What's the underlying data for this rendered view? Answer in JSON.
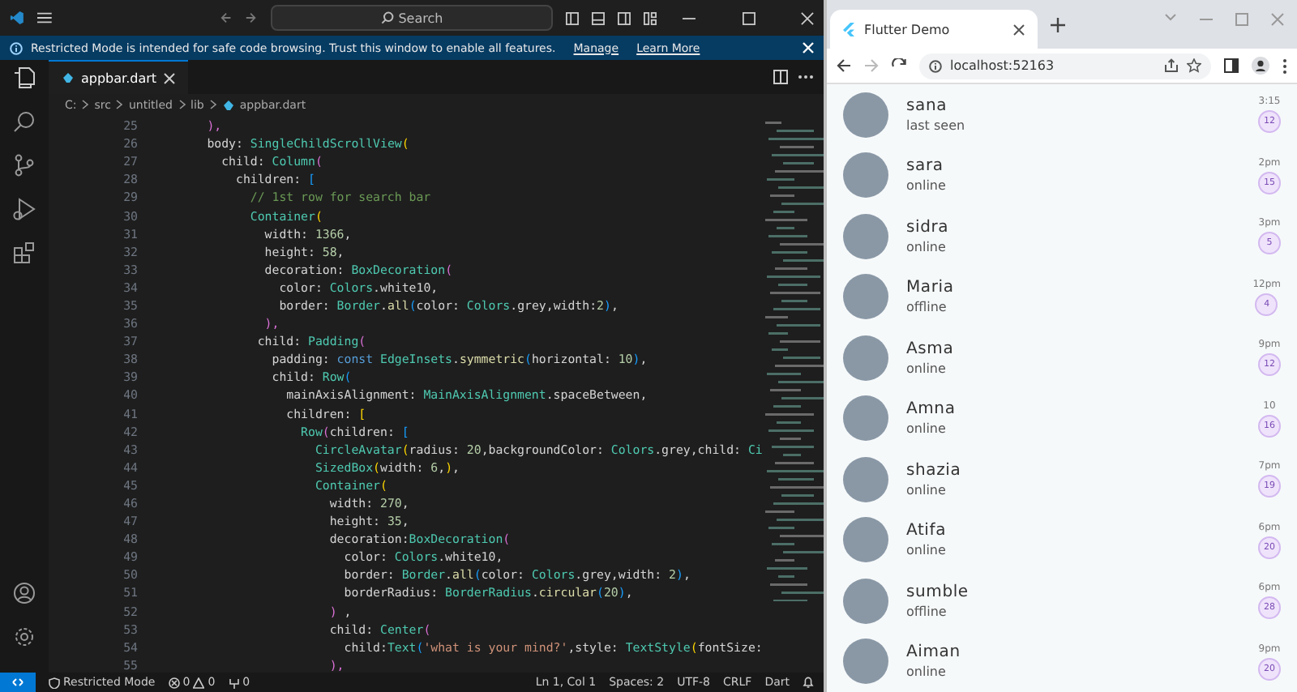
{
  "vscode": {
    "title_bar": {
      "search_placeholder": "Search"
    },
    "banner": {
      "message": "Restricted Mode is intended for safe code browsing. Trust this window to enable all features.",
      "links": [
        "Manage",
        "Learn More"
      ]
    },
    "tabs": [
      {
        "label": "appbar.dart",
        "selected": true
      }
    ],
    "breadcrumb": [
      "C:",
      "src",
      "untitled",
      "lib",
      "appbar.dart"
    ],
    "code_lines": [
      {
        "number": "25",
        "tokens": [
          {
            "text": "      ),",
            "kind": "bracket2"
          }
        ]
      },
      {
        "number": "26",
        "tokens": [
          {
            "text": "      body: ",
            "kind": "plain"
          },
          {
            "text": "SingleChildScrollView",
            "kind": "type"
          },
          {
            "text": "(",
            "kind": "bracket"
          }
        ]
      },
      {
        "number": "27",
        "tokens": [
          {
            "text": "        child: ",
            "kind": "plain"
          },
          {
            "text": "Column",
            "kind": "type"
          },
          {
            "text": "(",
            "kind": "bracket2"
          }
        ]
      },
      {
        "number": "28",
        "tokens": [
          {
            "text": "          children: ",
            "kind": "plain"
          },
          {
            "text": "[",
            "kind": "bracket3"
          }
        ]
      },
      {
        "number": "29",
        "tokens": [
          {
            "text": "            // 1st row for search bar",
            "kind": "comment"
          }
        ]
      },
      {
        "number": "30",
        "tokens": [
          {
            "text": "            Container",
            "kind": "type"
          },
          {
            "text": "(",
            "kind": "bracket"
          }
        ]
      },
      {
        "number": "31",
        "tokens": [
          {
            "text": "              width: ",
            "kind": "plain"
          },
          {
            "text": "1366",
            "kind": "number"
          },
          {
            "text": ",",
            "kind": "plain"
          }
        ]
      },
      {
        "number": "32",
        "tokens": [
          {
            "text": "              height: ",
            "kind": "plain"
          },
          {
            "text": "58",
            "kind": "number"
          },
          {
            "text": ",",
            "kind": "plain"
          }
        ]
      },
      {
        "number": "33",
        "tokens": [
          {
            "text": "              decoration: ",
            "kind": "plain"
          },
          {
            "text": "BoxDecoration",
            "kind": "type"
          },
          {
            "text": "(",
            "kind": "bracket2"
          }
        ]
      },
      {
        "number": "34",
        "tokens": [
          {
            "text": "                color: ",
            "kind": "plain"
          },
          {
            "text": "Colors",
            "kind": "type"
          },
          {
            "text": ".white10,",
            "kind": "plain"
          }
        ]
      },
      {
        "number": "35",
        "tokens": [
          {
            "text": "                border: ",
            "kind": "plain"
          },
          {
            "text": "Border",
            "kind": "type"
          },
          {
            "text": ".",
            "kind": "plain"
          },
          {
            "text": "all",
            "kind": "method"
          },
          {
            "text": "(",
            "kind": "bracket3"
          },
          {
            "text": "color: ",
            "kind": "plain"
          },
          {
            "text": "Colors",
            "kind": "type"
          },
          {
            "text": ".grey,width:",
            "kind": "plain"
          },
          {
            "text": "2",
            "kind": "number"
          },
          {
            "text": ")",
            "kind": "bracket3"
          },
          {
            "text": ",",
            "kind": "plain"
          }
        ]
      },
      {
        "number": "36",
        "tokens": [
          {
            "text": "              ),",
            "kind": "bracket2"
          }
        ]
      },
      {
        "number": "37",
        "tokens": [
          {
            "text": "             child: ",
            "kind": "plain"
          },
          {
            "text": "Padding",
            "kind": "type"
          },
          {
            "text": "(",
            "kind": "bracket2"
          }
        ]
      },
      {
        "number": "38",
        "tokens": [
          {
            "text": "               padding: ",
            "kind": "plain"
          },
          {
            "text": "const ",
            "kind": "keyword"
          },
          {
            "text": "EdgeInsets",
            "kind": "type"
          },
          {
            "text": ".",
            "kind": "plain"
          },
          {
            "text": "symmetric",
            "kind": "method"
          },
          {
            "text": "(",
            "kind": "bracket3"
          },
          {
            "text": "horizontal: ",
            "kind": "plain"
          },
          {
            "text": "10",
            "kind": "number"
          },
          {
            "text": ")",
            "kind": "bracket3"
          },
          {
            "text": ",",
            "kind": "plain"
          }
        ]
      },
      {
        "number": "39",
        "tokens": [
          {
            "text": "               child: ",
            "kind": "plain"
          },
          {
            "text": "Row",
            "kind": "type"
          },
          {
            "text": "(",
            "kind": "bracket3"
          }
        ]
      },
      {
        "number": "40",
        "tokens": [
          {
            "text": "                 mainAxisAlignment: ",
            "kind": "plain"
          },
          {
            "text": "MainAxisAlignment",
            "kind": "type"
          },
          {
            "text": ".spaceBetween,",
            "kind": "plain"
          }
        ]
      },
      {
        "number": "41",
        "tokens": [
          {
            "text": "                 children: ",
            "kind": "plain"
          },
          {
            "text": "[",
            "kind": "bracket"
          }
        ]
      },
      {
        "number": "42",
        "tokens": [
          {
            "text": "                   Row",
            "kind": "type"
          },
          {
            "text": "(",
            "kind": "bracket2"
          },
          {
            "text": "children: ",
            "kind": "plain"
          },
          {
            "text": "[",
            "kind": "bracket3"
          }
        ]
      },
      {
        "number": "43",
        "tokens": [
          {
            "text": "                     CircleAvatar",
            "kind": "type"
          },
          {
            "text": "(",
            "kind": "bracket"
          },
          {
            "text": "radius: ",
            "kind": "plain"
          },
          {
            "text": "20",
            "kind": "number"
          },
          {
            "text": ",backgroundColor: ",
            "kind": "plain"
          },
          {
            "text": "Colors",
            "kind": "type"
          },
          {
            "text": ".grey,child: ",
            "kind": "plain"
          },
          {
            "text": "Ci",
            "kind": "type"
          }
        ]
      },
      {
        "number": "44",
        "tokens": [
          {
            "text": "                     SizedBox",
            "kind": "type"
          },
          {
            "text": "(",
            "kind": "bracket"
          },
          {
            "text": "width: ",
            "kind": "plain"
          },
          {
            "text": "6",
            "kind": "number"
          },
          {
            "text": ",",
            "kind": "plain"
          },
          {
            "text": ")",
            "kind": "bracket"
          },
          {
            "text": ",",
            "kind": "plain"
          }
        ]
      },
      {
        "number": "45",
        "tokens": [
          {
            "text": "                     Container",
            "kind": "type"
          },
          {
            "text": "(",
            "kind": "bracket"
          }
        ]
      },
      {
        "number": "46",
        "tokens": [
          {
            "text": "                       width: ",
            "kind": "plain"
          },
          {
            "text": "270",
            "kind": "number"
          },
          {
            "text": ",",
            "kind": "plain"
          }
        ]
      },
      {
        "number": "47",
        "tokens": [
          {
            "text": "                       height: ",
            "kind": "plain"
          },
          {
            "text": "35",
            "kind": "number"
          },
          {
            "text": ",",
            "kind": "plain"
          }
        ]
      },
      {
        "number": "48",
        "tokens": [
          {
            "text": "                       decoration:",
            "kind": "plain"
          },
          {
            "text": "BoxDecoration",
            "kind": "type"
          },
          {
            "text": "(",
            "kind": "bracket2"
          }
        ]
      },
      {
        "number": "49",
        "tokens": [
          {
            "text": "                         color: ",
            "kind": "plain"
          },
          {
            "text": "Colors",
            "kind": "type"
          },
          {
            "text": ".white10,",
            "kind": "plain"
          }
        ]
      },
      {
        "number": "50",
        "tokens": [
          {
            "text": "                         border: ",
            "kind": "plain"
          },
          {
            "text": "Border",
            "kind": "type"
          },
          {
            "text": ".",
            "kind": "plain"
          },
          {
            "text": "all",
            "kind": "method"
          },
          {
            "text": "(",
            "kind": "bracket3"
          },
          {
            "text": "color: ",
            "kind": "plain"
          },
          {
            "text": "Colors",
            "kind": "type"
          },
          {
            "text": ".grey,width: ",
            "kind": "plain"
          },
          {
            "text": "2",
            "kind": "number"
          },
          {
            "text": ")",
            "kind": "bracket3"
          },
          {
            "text": ",",
            "kind": "plain"
          }
        ]
      },
      {
        "number": "51",
        "tokens": [
          {
            "text": "                         borderRadius: ",
            "kind": "plain"
          },
          {
            "text": "BorderRadius",
            "kind": "type"
          },
          {
            "text": ".",
            "kind": "plain"
          },
          {
            "text": "circular",
            "kind": "method"
          },
          {
            "text": "(",
            "kind": "bracket3"
          },
          {
            "text": "20",
            "kind": "number"
          },
          {
            "text": ")",
            "kind": "bracket3"
          },
          {
            "text": ",",
            "kind": "plain"
          }
        ]
      },
      {
        "number": "52",
        "tokens": [
          {
            "text": "                       )",
            "kind": "bracket2"
          },
          {
            "text": " ,",
            "kind": "plain"
          }
        ]
      },
      {
        "number": "53",
        "tokens": [
          {
            "text": "                       child: ",
            "kind": "plain"
          },
          {
            "text": "Center",
            "kind": "type"
          },
          {
            "text": "(",
            "kind": "bracket2"
          }
        ]
      },
      {
        "number": "54",
        "tokens": [
          {
            "text": "                         child:",
            "kind": "plain"
          },
          {
            "text": "Text",
            "kind": "type"
          },
          {
            "text": "(",
            "kind": "bracket3"
          },
          {
            "text": "'what is your mind?'",
            "kind": "string"
          },
          {
            "text": ",style: ",
            "kind": "plain"
          },
          {
            "text": "TextStyle",
            "kind": "type"
          },
          {
            "text": "(",
            "kind": "bracket"
          },
          {
            "text": "fontSize:",
            "kind": "plain"
          }
        ]
      },
      {
        "number": "55",
        "tokens": [
          {
            "text": "                       ),",
            "kind": "bracket2"
          }
        ]
      }
    ],
    "status_bar": {
      "mode": "Restricted Mode",
      "errors": "0",
      "warnings": "0",
      "ports": "0",
      "right": [
        "Ln 1, Col 1",
        "Spaces: 2",
        "UTF-8",
        "CRLF",
        "Dart"
      ]
    }
  },
  "browser": {
    "tabs": [
      {
        "title": "Flutter Demo",
        "selected": true
      }
    ],
    "forward": {
      "disabled": true
    },
    "address": "localhost:52163",
    "contacts": [
      {
        "name": "sana",
        "status": "last seen",
        "time": "3:15",
        "unread": "12"
      },
      {
        "name": "sara",
        "status": "online",
        "time": "2pm",
        "unread": "15"
      },
      {
        "name": "sidra",
        "status": "online",
        "time": "3pm",
        "unread": "5"
      },
      {
        "name": "Maria",
        "status": "offline",
        "time": "12pm",
        "unread": "4"
      },
      {
        "name": "Asma",
        "status": "online",
        "time": "9pm",
        "unread": "12"
      },
      {
        "name": "Amna",
        "status": "online",
        "time": "10",
        "unread": "16"
      },
      {
        "name": "shazia",
        "status": "online",
        "time": "7pm",
        "unread": "19"
      },
      {
        "name": "Atifa",
        "status": "online",
        "time": "6pm",
        "unread": "20"
      },
      {
        "name": "sumble",
        "status": "offline",
        "time": "6pm",
        "unread": "28"
      },
      {
        "name": "Aiman",
        "status": "online",
        "time": "9pm",
        "unread": "20"
      }
    ]
  }
}
